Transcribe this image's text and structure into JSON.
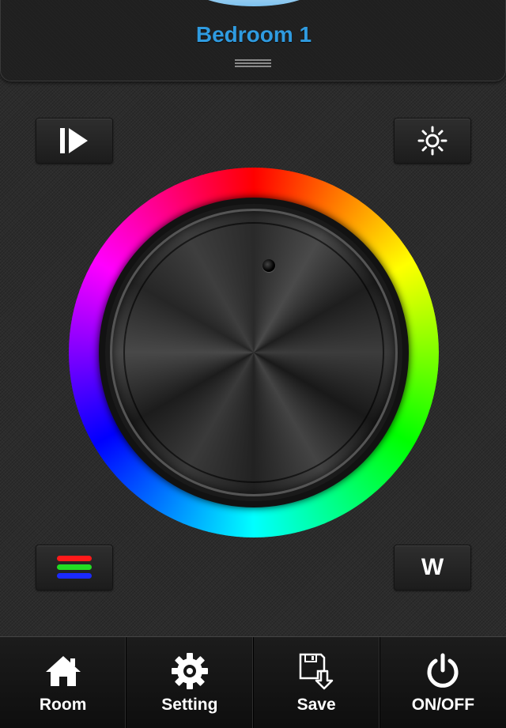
{
  "header": {
    "room_title": "Bedroom 1"
  },
  "controls": {
    "play_icon": "play-pause-icon",
    "brightness_icon": "brightness-sun-icon",
    "rgb_icon": "rgb-bars-icon",
    "white_label": "W"
  },
  "rgb_colors": [
    "#ff1a1a",
    "#22dd22",
    "#1a2aff"
  ],
  "accent": "#2f9be0",
  "tabbar": {
    "tabs": [
      {
        "label": "Room",
        "icon": "home-icon"
      },
      {
        "label": "Setting",
        "icon": "gear-icon"
      },
      {
        "label": "Save",
        "icon": "save-icon"
      },
      {
        "label": "ON/OFF",
        "icon": "power-icon"
      }
    ]
  }
}
